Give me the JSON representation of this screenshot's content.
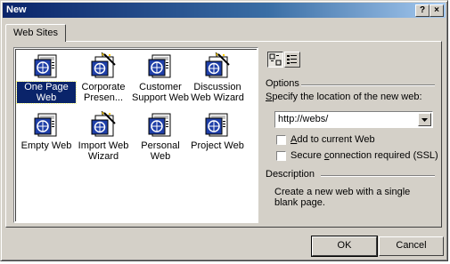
{
  "window": {
    "title": "New",
    "help_button": "?",
    "close_button": "×"
  },
  "tabs": [
    {
      "label": "Web Sites",
      "active": true
    }
  ],
  "templates": [
    {
      "label": "One Page Web",
      "icon": "web-page-icon",
      "selected": true
    },
    {
      "label": "Corporate Presen...",
      "icon": "web-wizard-icon",
      "selected": false
    },
    {
      "label": "Customer Support Web",
      "icon": "web-page-icon",
      "selected": false
    },
    {
      "label": "Discussion Web Wizard",
      "icon": "web-wizard-icon",
      "selected": false
    },
    {
      "label": "Empty Web",
      "icon": "web-page-icon",
      "selected": false
    },
    {
      "label": "Import Web Wizard",
      "icon": "web-wizard-icon",
      "selected": false
    },
    {
      "label": "Personal Web",
      "icon": "web-page-icon",
      "selected": false
    },
    {
      "label": "Project Web",
      "icon": "web-page-icon",
      "selected": false
    }
  ],
  "view_buttons": [
    {
      "name": "large-icons-view",
      "pressed": true
    },
    {
      "name": "list-view",
      "pressed": false
    }
  ],
  "options": {
    "group_label": "Options",
    "location_label_prefix": "S",
    "location_label_rest": "pecify the location of the new web:",
    "location_value": "http://webs/",
    "add_to_current_prefix": "A",
    "add_to_current_rest": "dd to current Web",
    "add_to_current_checked": false,
    "ssl_prefix": "Secure ",
    "ssl_underlined": "c",
    "ssl_rest": "onnection required (SSL)",
    "ssl_checked": false
  },
  "description": {
    "group_label": "Description",
    "text": "Create a new web with a single blank page."
  },
  "buttons": {
    "ok": "OK",
    "cancel": "Cancel"
  },
  "colors": {
    "face": "#d4d0c8",
    "titlebar_start": "#0a246a",
    "titlebar_end": "#a6caf0",
    "selection": "#0a246a"
  }
}
